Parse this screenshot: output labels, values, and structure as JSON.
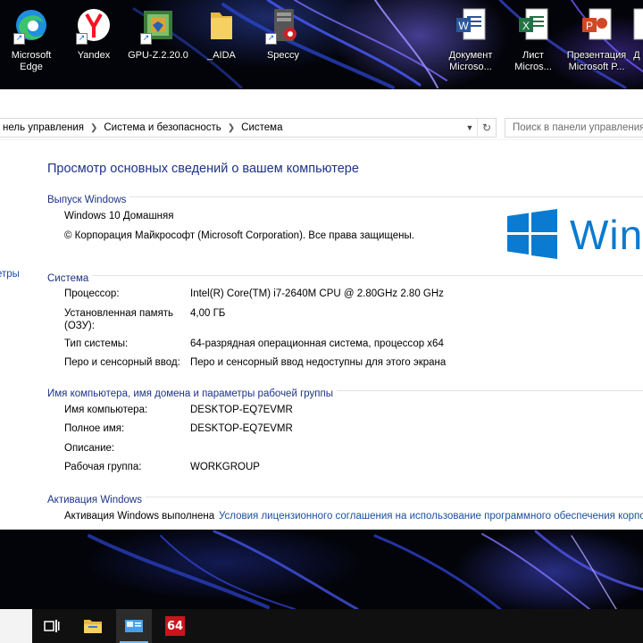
{
  "desktop": {
    "icons": [
      {
        "label_1": "Microsoft",
        "label_2": "Edge",
        "icon": "edge-icon"
      },
      {
        "label_1": "Yandex",
        "label_2": "",
        "icon": "yandex-icon"
      },
      {
        "label_1": "GPU-Z.2.20.0",
        "label_2": "",
        "icon": "gpuz-icon"
      },
      {
        "label_1": "_AIDA",
        "label_2": "",
        "icon": "folder-icon"
      },
      {
        "label_1": "Speccy",
        "label_2": "",
        "icon": "speccy-icon"
      },
      {
        "label_1": "Документ",
        "label_2": "Microso...",
        "icon": "word-icon"
      },
      {
        "label_1": "Лист",
        "label_2": "Micros...",
        "icon": "excel-icon"
      },
      {
        "label_1": "Презентация",
        "label_2": "Microsoft P...",
        "icon": "powerpoint-icon"
      }
    ],
    "partial_icon_label": "Д"
  },
  "address_bar": {
    "crumbs": [
      "нель управления",
      "Система и безопасность",
      "Система"
    ],
    "search_placeholder": "Поиск в панели управления"
  },
  "sidebar": {
    "partial_link": "етры"
  },
  "main": {
    "title": "Просмотр основных сведений о вашем компьютере",
    "windows_edition": {
      "heading": "Выпуск Windows",
      "edition": "Windows 10 Домашняя",
      "copyright": "© Корпорация Майкрософт (Microsoft Corporation). Все права защищены.",
      "logo_text": "Wind"
    },
    "system": {
      "heading": "Система",
      "rows": [
        {
          "key": "Процессор:",
          "value": "Intel(R) Core(TM) i7-2640M CPU @ 2.80GHz   2.80 GHz"
        },
        {
          "key": "Установленная память",
          "key_2": "(ОЗУ):",
          "value": "4,00 ГБ"
        },
        {
          "key": "Тип системы:",
          "value": "64-разрядная операционная система, процессор x64"
        },
        {
          "key": "Перо и сенсорный ввод:",
          "value": "Перо и сенсорный ввод недоступны для этого экрана"
        }
      ]
    },
    "computer_name": {
      "heading": "Имя компьютера, имя домена и параметры рабочей группы",
      "rows": [
        {
          "key": "Имя компьютера:",
          "value": "DESKTOP-EQ7EVMR"
        },
        {
          "key": "Полное имя:",
          "value": "DESKTOP-EQ7EVMR"
        },
        {
          "key": "Описание:",
          "value": ""
        },
        {
          "key": "Рабочая группа:",
          "value": "WORKGROUP"
        }
      ]
    },
    "activation": {
      "heading": "Активация Windows",
      "status": "Активация Windows выполнена",
      "license_link": "Условия лицензионного соглашения на использование программного обеспечения корпо"
    }
  },
  "taskbar": {
    "items": [
      {
        "icon": "task-view-icon"
      },
      {
        "icon": "file-explorer-icon"
      },
      {
        "icon": "system-window-icon",
        "active": true
      },
      {
        "icon": "aida64-icon",
        "label": "64"
      }
    ]
  },
  "colors": {
    "heading_blue": "#1e3287",
    "link_blue": "#1a4f9c",
    "windows_logo_blue": "#0a7bd0",
    "taskbar": "#101010"
  }
}
